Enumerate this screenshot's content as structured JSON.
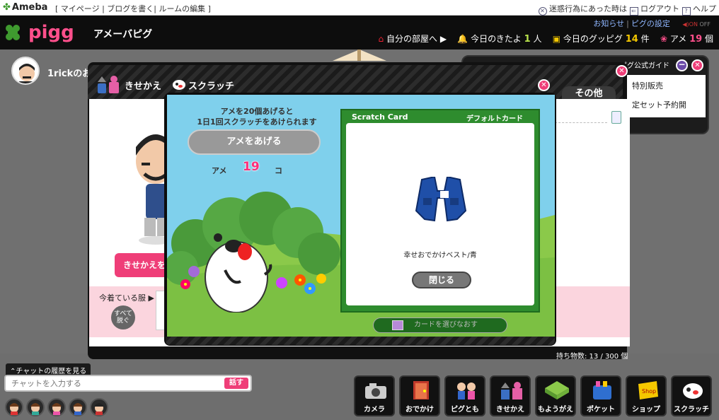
{
  "ameba_bar": {
    "logo": "Ameba",
    "links": "[ マイページ |  ブログを書く|  ルームの編集 ]",
    "report_text": "迷惑行為にあった時は",
    "logout": "ログアウト",
    "help": "ヘルプ"
  },
  "header": {
    "title": "アメーバピグ",
    "news": "お知らせ",
    "settings": "ピグの設定",
    "sound_on": "ON",
    "sound_off": "OFF",
    "my_room": "自分の部屋へ",
    "visitors_label": "今日のきたよ",
    "visitors_count": "1",
    "visitors_unit": "人",
    "good_label": "今日のグッピグ",
    "good_count": "14",
    "good_unit": "件",
    "ame_label": "アメ",
    "ame_count": "19",
    "ame_unit": "個"
  },
  "user": {
    "name": "1rickのお"
  },
  "guide": {
    "title": "ピグ公式ガイド",
    "item1": "特別販売",
    "item2": "定セット予約開"
  },
  "kisekae": {
    "title": "きせかえ",
    "other_tab": "その他",
    "kisekae_button": "きせかえを",
    "wearing_label": "今着ている服",
    "take_off_all": "すべて脱ぐ",
    "count_text": "持ち物数: 13 / 300 個"
  },
  "scratch": {
    "title": "スクラッチ",
    "instruction_line1": "アメを20個あげると",
    "instruction_line2": "1日1回スクラッチをあけられます",
    "give_button": "アメをあげる",
    "ame_label": "アメ",
    "ame_count": "19",
    "ame_unit": "コ",
    "card_title": "Scratch Card",
    "card_type": "デフォルトカード",
    "item_name": "幸せおでかけベスト/青",
    "close_button": "閉じる",
    "choose_card": "カードを選びなおす"
  },
  "chat": {
    "history_link": "チャットの履歴を見る",
    "placeholder": "チャットを入力する",
    "talk_button": "話す"
  },
  "menu": {
    "camera": "カメラ",
    "outing": "おでかけ",
    "friends": "ピグとも",
    "kisekae": "きせかえ",
    "remodel": "もようがえ",
    "pocket": "ポケット",
    "shop": "ショップ",
    "scratch": "スクラッチ"
  },
  "colors": {
    "accent_pink": "#ef3e78",
    "pigg_green": "#3f9a2f",
    "card_green": "#2e8c2e",
    "sky_blue": "#7fd0ec"
  }
}
